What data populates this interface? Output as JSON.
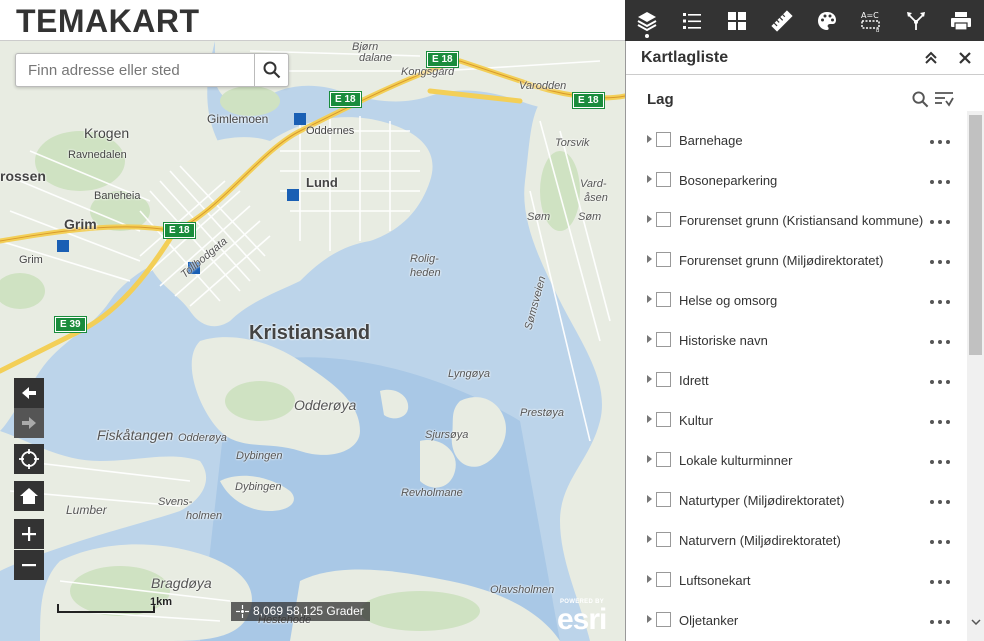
{
  "header": {
    "title": "TEMAKART"
  },
  "toolbar": {
    "items": [
      {
        "name": "layers-icon",
        "active": true
      },
      {
        "name": "legend-icon",
        "active": false
      },
      {
        "name": "basemap-gallery-icon",
        "active": false
      },
      {
        "name": "measure-icon",
        "active": false
      },
      {
        "name": "draw-icon",
        "active": false
      },
      {
        "name": "attribute-table-icon",
        "active": false
      },
      {
        "name": "share-icon",
        "active": false
      },
      {
        "name": "print-icon",
        "active": false
      }
    ]
  },
  "search": {
    "placeholder": "Finn adresse eller sted"
  },
  "map": {
    "scale_label": "1km",
    "coordinates": "8,069 58,125 Grader",
    "esri_powered_by": "POWERED BY",
    "esri_word": "esri",
    "labels": {
      "city": "Kristiansand",
      "krogen": "Krogen",
      "ravnedalen": "Ravnedalen",
      "baneheia": "Baneheia",
      "rossen": "rossen",
      "grim1": "Grim",
      "grim2": "Grim",
      "gimlemoen": "Gimlemoen",
      "oddernes": "Oddernes",
      "lund": "Lund",
      "kongsgard": "Kongsgård",
      "bjorn": "Bjørn",
      "dalane": "dalane",
      "varodden": "Varodden",
      "torsvik": "Torsvik",
      "vard": "Vard-",
      "asen": "åsen",
      "som1": "Søm",
      "som2": "Søm",
      "somsveien": "Sømsveien",
      "roligheden1": "Rolig-",
      "roligheden2": "heden",
      "tollbodgata": "Tollbodgata",
      "odderoya": "Odderøya",
      "odderoya2": "Odderøya",
      "fiskatangen": "Fiskåtangen",
      "lyngoya": "Lyngøya",
      "prestoya": "Prestøya",
      "sjursoya": "Sjursøya",
      "dybingen1": "Dybingen",
      "dybingen2": "Dybingen",
      "svensholmen1": "Svens-",
      "svensholmen2": "holmen",
      "lumber": "Lumber",
      "revholmane": "Revholmane",
      "bragdoya": "Bragdøya",
      "olavsholmen": "Olavsholmen",
      "hestehode": "Hestehode"
    },
    "shields": [
      "E 18",
      "E 18",
      "E 18",
      "E 18",
      "E 39"
    ]
  },
  "panel": {
    "title": "Kartlagliste",
    "lag_title": "Lag",
    "layers": [
      "Barnehage",
      "Bosoneparkering",
      "Forurenset grunn (Kristiansand kommune)",
      "Forurenset grunn (Miljødirektoratet)",
      "Helse og omsorg",
      "Historiske navn",
      "Idrett",
      "Kultur",
      "Lokale kulturminner",
      "Naturtyper (Miljødirektoratet)",
      "Naturvern (Miljødirektoratet)",
      "Luftsonekart",
      "Oljetanker"
    ]
  },
  "colors": {
    "toolbar_bg": "#333333",
    "water": "#bcd4ea",
    "land": "#e9ece3",
    "road_major": "#f3cf57",
    "shield_green": "#1a8c3c"
  }
}
